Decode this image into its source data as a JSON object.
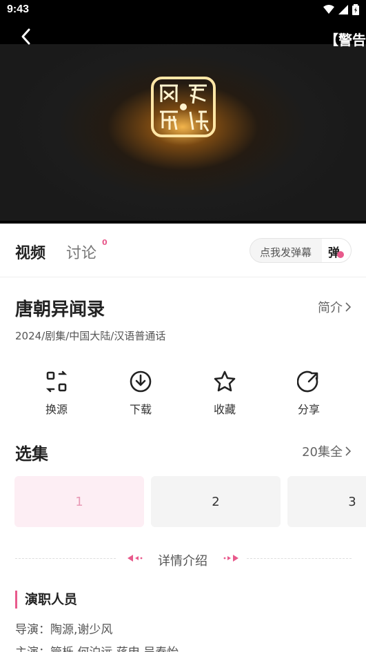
{
  "status_bar": {
    "time": "9:43"
  },
  "player": {
    "title": "【警告"
  },
  "tabs": {
    "video": "视频",
    "discuss": "讨论",
    "discuss_count": "0"
  },
  "danmaku": {
    "placeholder": "点我发弹幕",
    "toggle_label": "弹"
  },
  "show": {
    "title": "唐朝异闻录",
    "intro_link": "简介",
    "meta": "2024/剧集/中国大陆/汉语普通话"
  },
  "actions": [
    {
      "label": "换源",
      "icon": "switch-source-icon"
    },
    {
      "label": "下载",
      "icon": "download-icon"
    },
    {
      "label": "收藏",
      "icon": "star-icon"
    },
    {
      "label": "分享",
      "icon": "share-icon"
    }
  ],
  "episodes": {
    "header": "选集",
    "all_label": "20集全",
    "items": [
      "1",
      "2",
      "3"
    ],
    "selected": "1"
  },
  "details": {
    "divider_label": "详情介绍",
    "cast_header": "演职人员",
    "director_label": "导演：",
    "director": "陶源,谢少风",
    "cast_label": "主演：",
    "cast": "管栎,何泊远,蒋申,吴春怡"
  },
  "colors": {
    "accent": "#e85a8c",
    "selected_episode_bg": "#fdeef4"
  }
}
